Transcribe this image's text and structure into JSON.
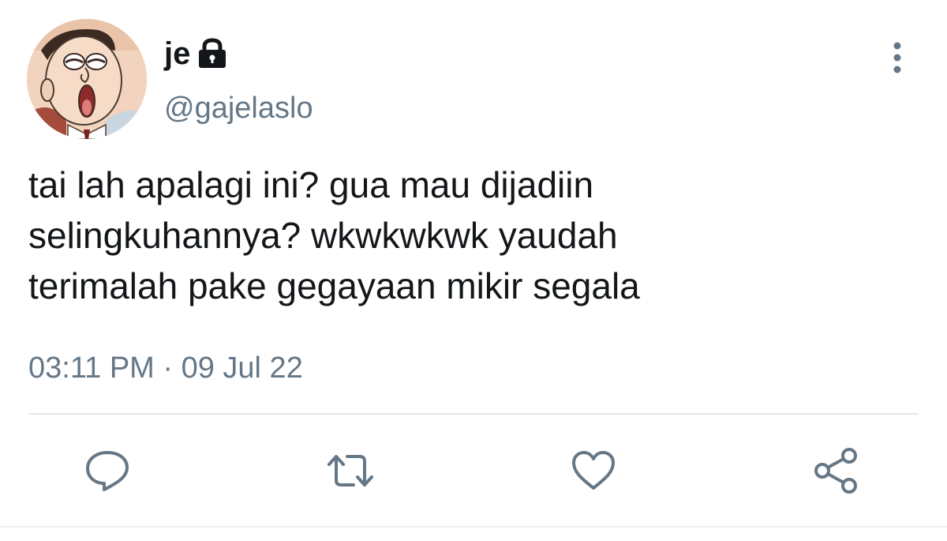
{
  "user": {
    "display_name": "je",
    "handle": "@gajelaslo",
    "protected": true,
    "avatar_icon": "cartoon-avatar"
  },
  "tweet": {
    "text": "tai lah apalagi ini? gua mau dijadiin\nselingkuhannya? wkwkwkwk yaudah\nterimalah pake gegayaan mikir segala",
    "timestamp": "03:11 PM · 09 Jul 22"
  },
  "actions": [
    {
      "name": "reply",
      "icon": "reply-icon"
    },
    {
      "name": "retweet",
      "icon": "retweet-icon"
    },
    {
      "name": "like",
      "icon": "heart-icon"
    },
    {
      "name": "share",
      "icon": "share-icon"
    }
  ],
  "menu": {
    "icon": "more-vertical-icon"
  },
  "colors": {
    "text_primary": "#14171a",
    "text_secondary": "#657786",
    "icon": "#657786",
    "divider": "#e1e8ed"
  }
}
